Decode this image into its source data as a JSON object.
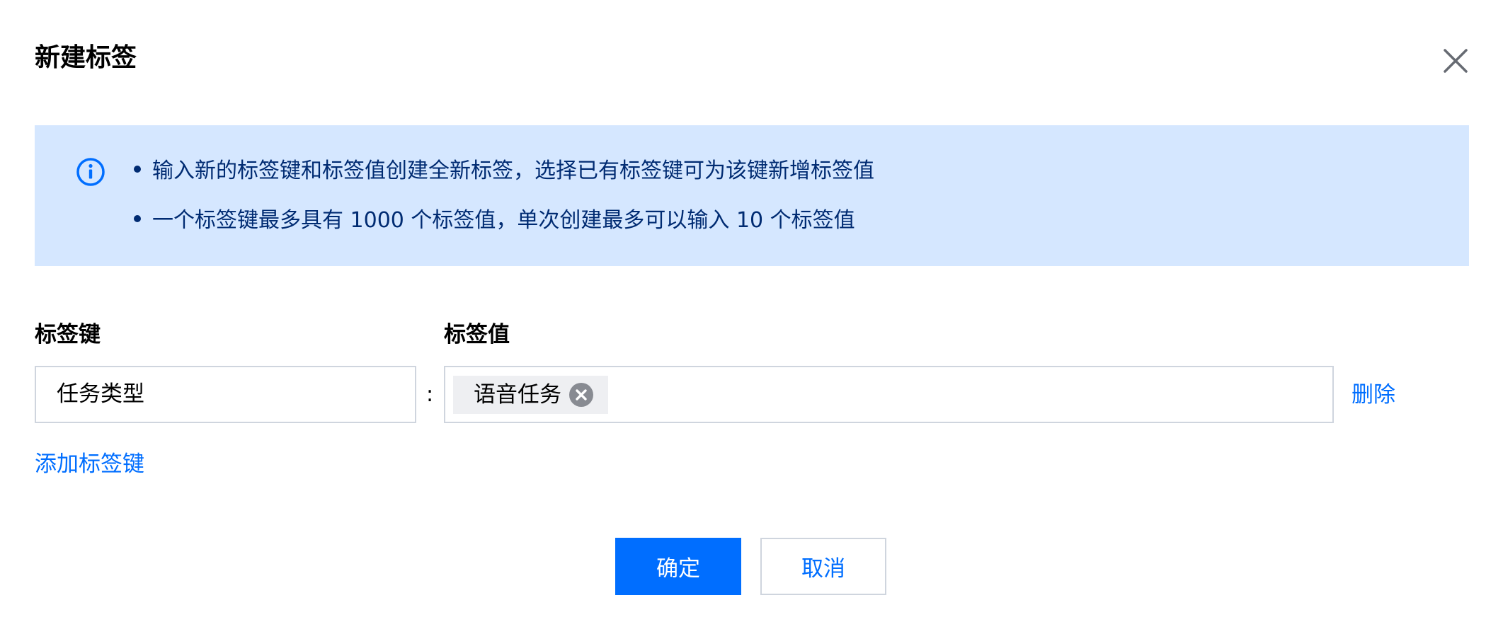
{
  "dialog": {
    "title": "新建标签",
    "close_icon": "close-icon"
  },
  "notice": {
    "icon": "info-circle-icon",
    "lines": [
      "输入新的标签键和标签值创建全新标签，选择已有标签键可为该键新增标签值",
      "一个标签键最多具有 1000 个标签值，单次创建最多可以输入 10 个标签值"
    ]
  },
  "form": {
    "key_label": "标签键",
    "value_label": "标签值",
    "separator": ":",
    "rows": [
      {
        "key": "任务类型",
        "values": [
          "语音任务"
        ],
        "delete_label": "删除"
      }
    ],
    "add_key_label": "添加标签键"
  },
  "actions": {
    "confirm_label": "确定",
    "cancel_label": "取消"
  },
  "colors": {
    "primary": "#006eff",
    "notice_bg": "#d5e7ff",
    "notice_text": "#002b72",
    "border": "#cfd5de",
    "chip_bg": "#eeeff2"
  }
}
